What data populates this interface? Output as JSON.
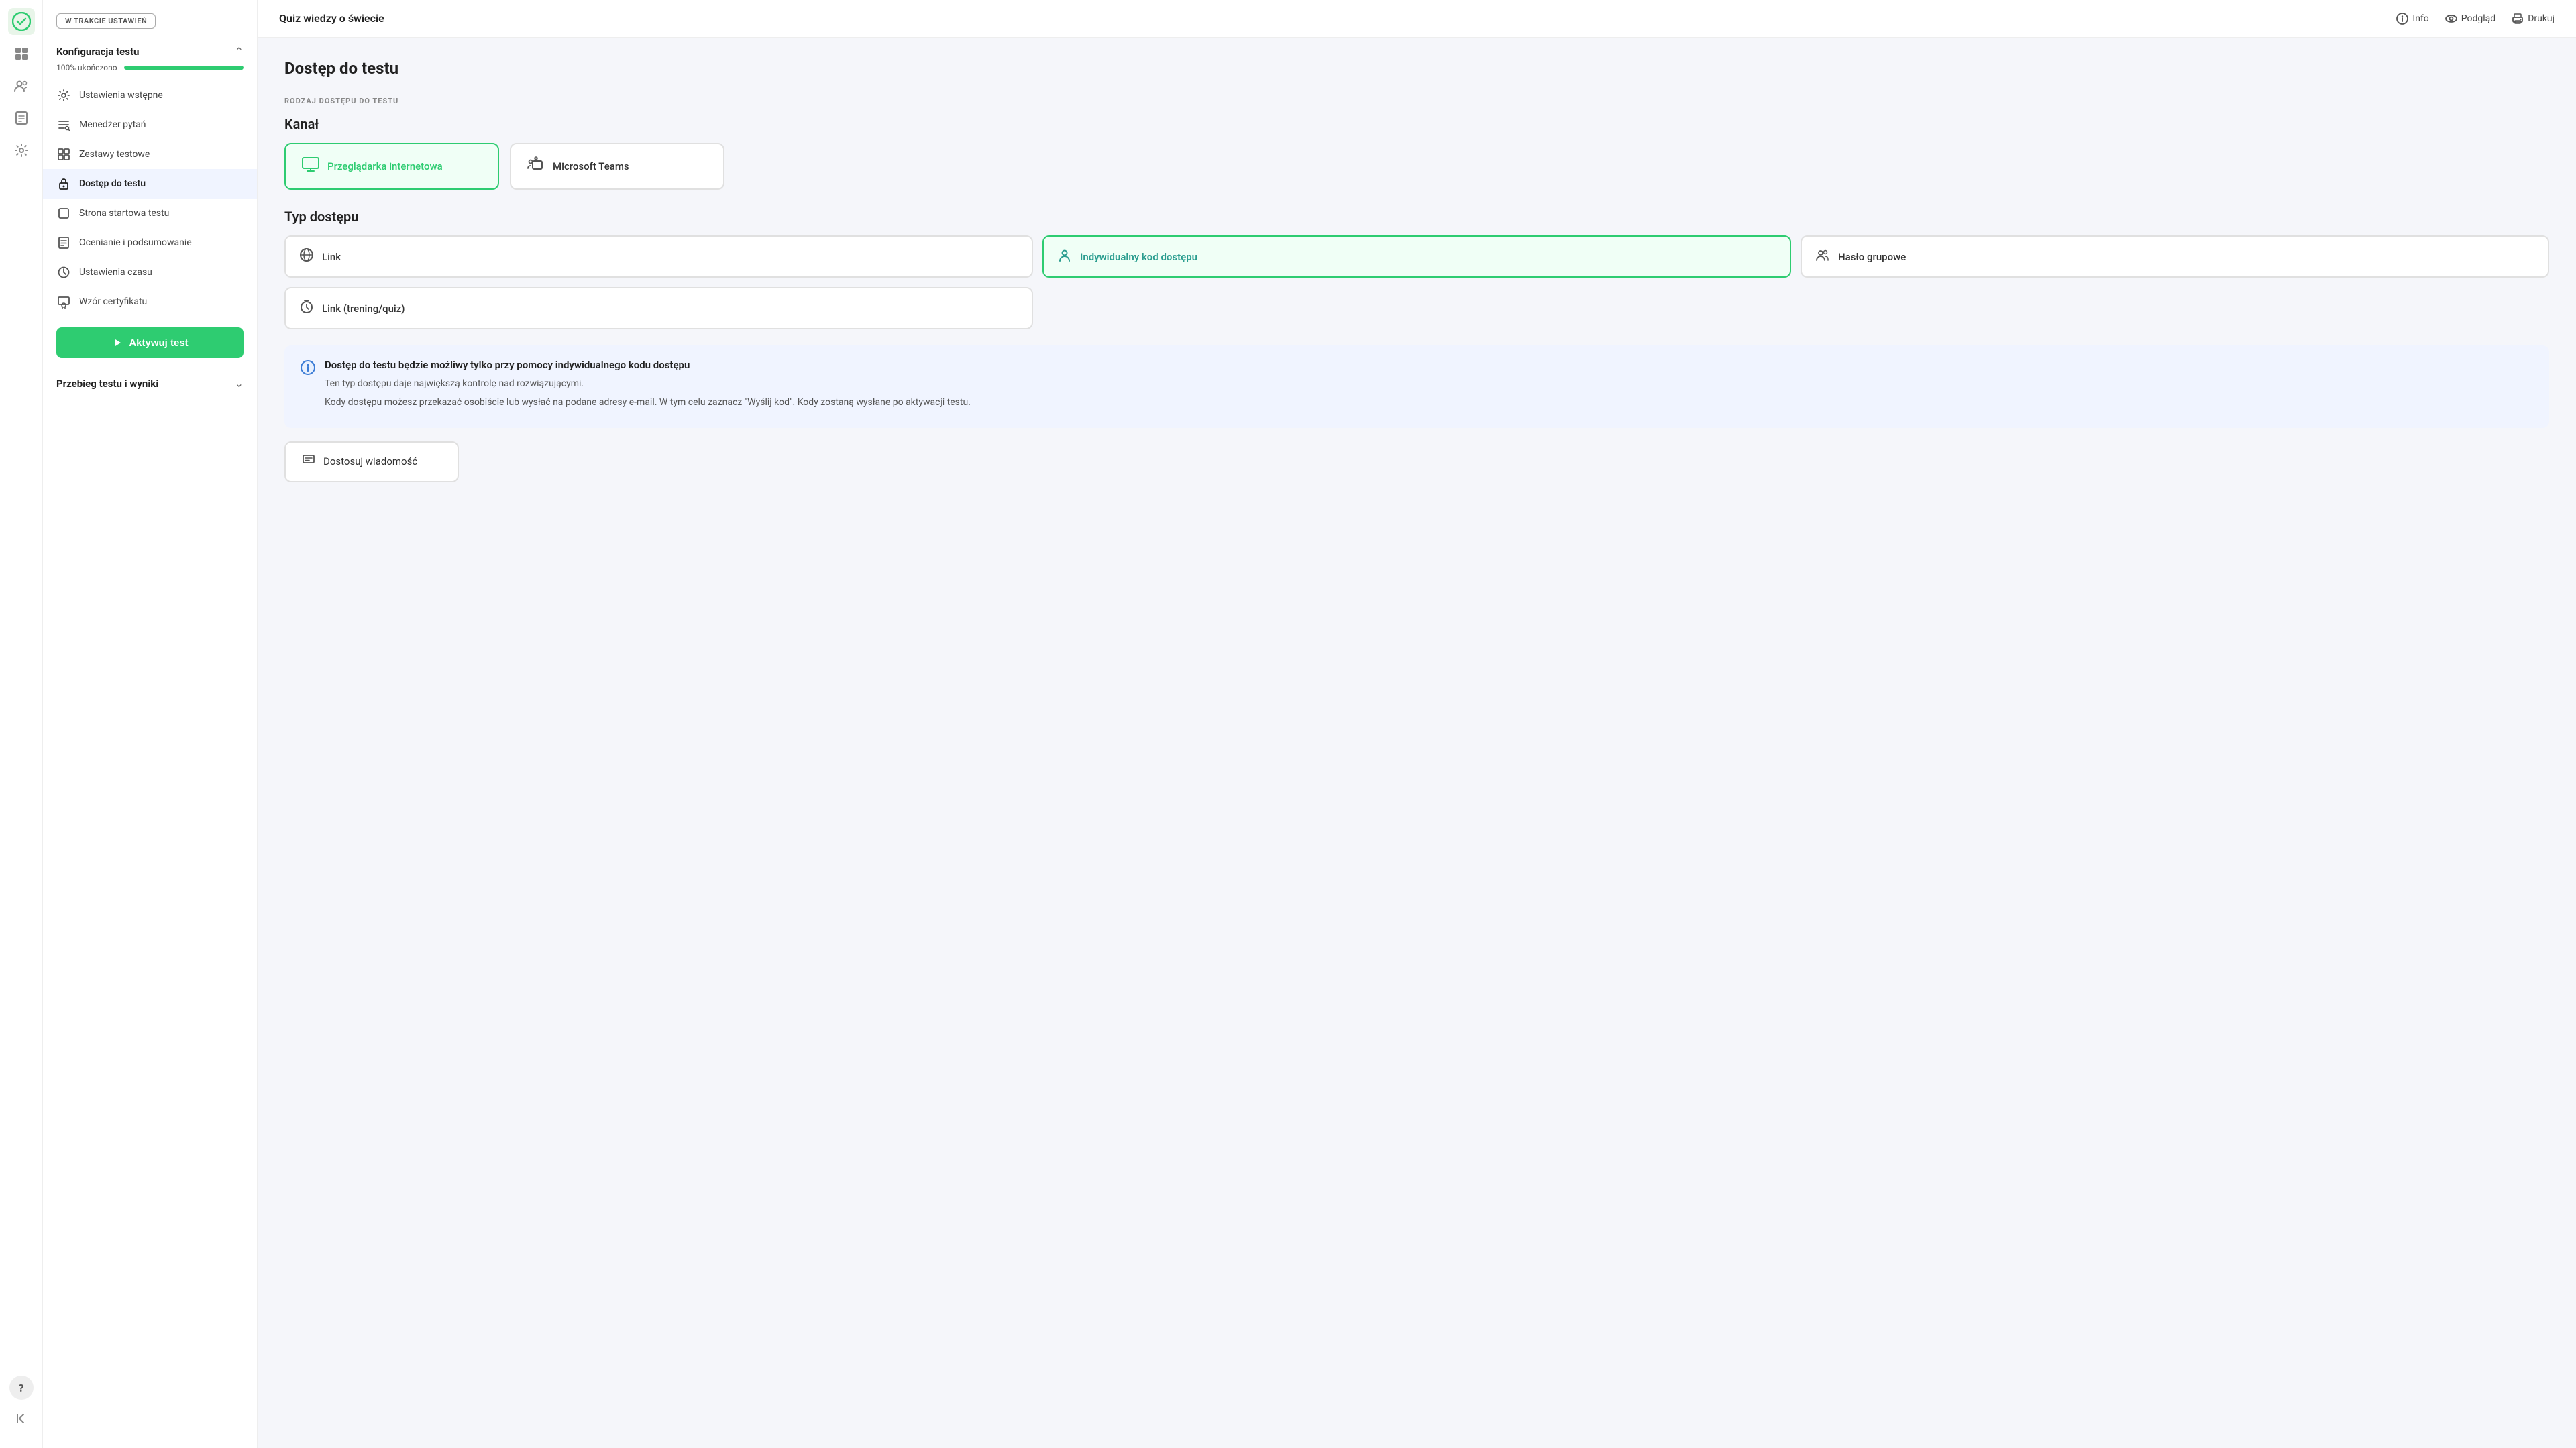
{
  "app": {
    "title": "Quiz wiedzy o świecie",
    "logo_icon": "✓"
  },
  "topbar": {
    "info_label": "Info",
    "podglad_label": "Podgląd",
    "drukuj_label": "Drukuj"
  },
  "sidebar": {
    "status_badge": "W TRAKCIE USTAWIEŃ",
    "konfiguracja_section": "Konfiguracja testu",
    "progress_label": "100% ukończono",
    "progress_percent": 100,
    "nav_items": [
      {
        "label": "Ustawienia wstępne",
        "icon": "⚙"
      },
      {
        "label": "Menedżer pytań",
        "icon": "≡"
      },
      {
        "label": "Zestawy testowe",
        "icon": "⊞"
      },
      {
        "label": "Dostęp do testu",
        "icon": "🔒"
      },
      {
        "label": "Strona startowa testu",
        "icon": "◻"
      },
      {
        "label": "Ocenianie i podsumowanie",
        "icon": "📄"
      },
      {
        "label": "Ustawienia czasu",
        "icon": "🕐"
      },
      {
        "label": "Wzór certyfikatu",
        "icon": "🏅"
      }
    ],
    "activate_btn": "Aktywuj test",
    "przebieg_section": "Przebieg testu i wyniki"
  },
  "icon_bar": {
    "items": [
      {
        "icon": "✓",
        "name": "logo",
        "active": true
      },
      {
        "icon": "⊞",
        "name": "grid"
      },
      {
        "icon": "👤",
        "name": "users"
      },
      {
        "icon": "📊",
        "name": "reports"
      },
      {
        "icon": "⚙",
        "name": "settings"
      }
    ],
    "bottom": [
      {
        "icon": "?",
        "name": "help"
      },
      {
        "icon": "←",
        "name": "back"
      }
    ]
  },
  "main": {
    "heading": "Dostęp do testu",
    "rodzaj_label": "RODZAJ DOSTĘPU DO TESTU",
    "kanal_label": "Kanał",
    "kanal_options": [
      {
        "label": "Przeglądarka internetowa",
        "icon": "🖥",
        "selected": true
      },
      {
        "label": "Microsoft Teams",
        "icon": "👥",
        "selected": false
      }
    ],
    "typ_label": "Typ dostępu",
    "typ_options": [
      {
        "label": "Link",
        "icon": "🌐",
        "selected": false
      },
      {
        "label": "Indywidualny kod dostępu",
        "icon": "👤",
        "selected": true
      },
      {
        "label": "Hasło grupowe",
        "icon": "👥",
        "selected": false
      }
    ],
    "typ_options2": [
      {
        "label": "Link (trening/quiz)",
        "icon": "⏱",
        "selected": false
      }
    ],
    "info_box": {
      "title": "Dostęp do testu będzie możliwy tylko przy pomocy indywidualnego kodu dostępu",
      "text1": "Ten typ dostępu daje największą kontrolę nad rozwiązującymi.",
      "text2": "Kody dostępu możesz przekazać osobiście lub wysłać na podane adresy e-mail. W tym celu zaznacz \"Wyślij kod\". Kody zostaną wysłane po aktywacji testu."
    },
    "dostosuj_label": "Dostosuj wiadomość"
  }
}
